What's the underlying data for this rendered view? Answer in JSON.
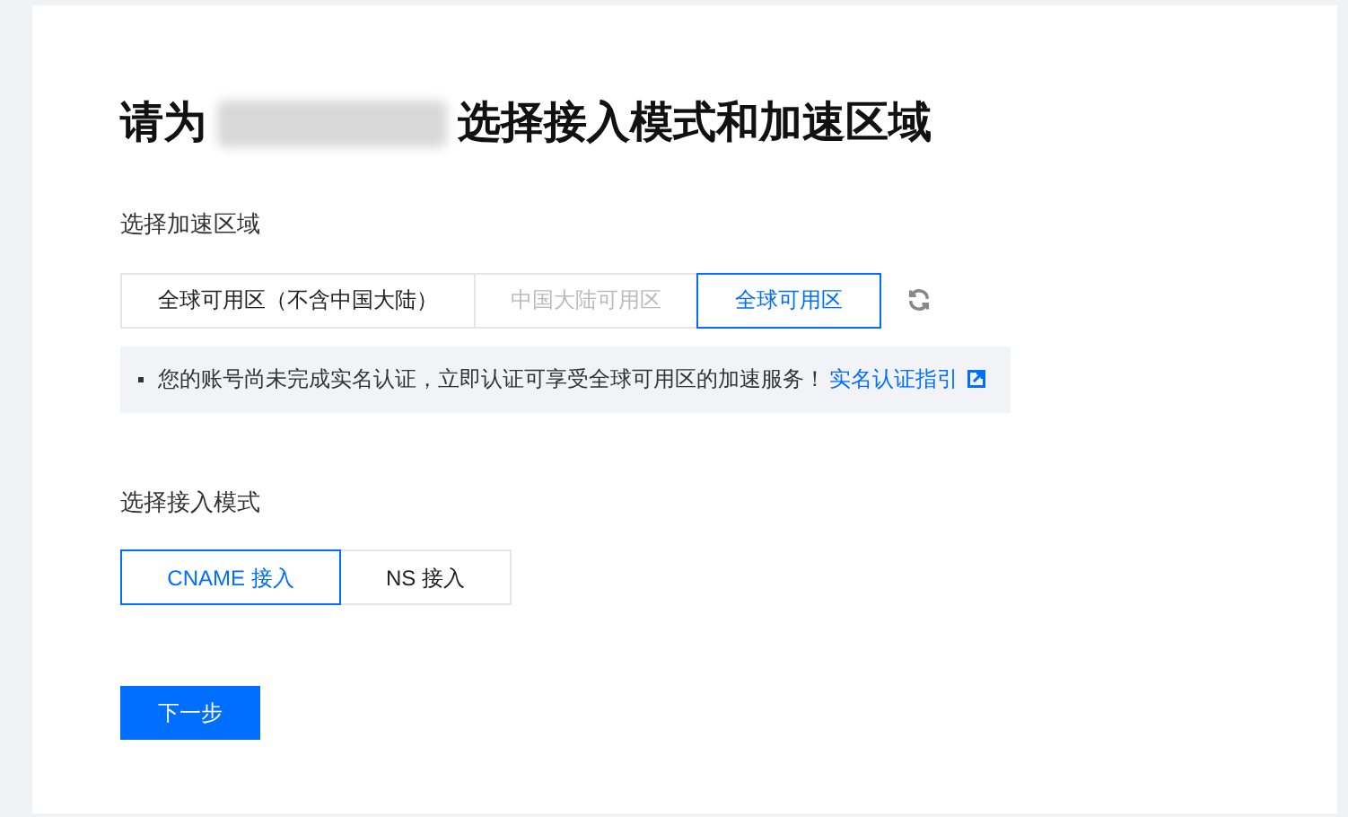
{
  "title": {
    "before": "请为",
    "after": "选择接入模式和加速区域"
  },
  "region": {
    "label": "选择加速区域",
    "options": [
      {
        "label": "全球可用区（不含中国大陆）",
        "selected": false,
        "disabled": false
      },
      {
        "label": "中国大陆可用区",
        "selected": false,
        "disabled": true
      },
      {
        "label": "全球可用区",
        "selected": true,
        "disabled": false
      }
    ]
  },
  "notice": {
    "text": "您的账号尚未完成实名认证，立即认证可享受全球可用区的加速服务！",
    "link": "实名认证指引"
  },
  "mode": {
    "label": "选择接入模式",
    "options": [
      {
        "label": "CNAME 接入",
        "selected": true
      },
      {
        "label": "NS 接入",
        "selected": false
      }
    ]
  },
  "next_button": "下一步"
}
